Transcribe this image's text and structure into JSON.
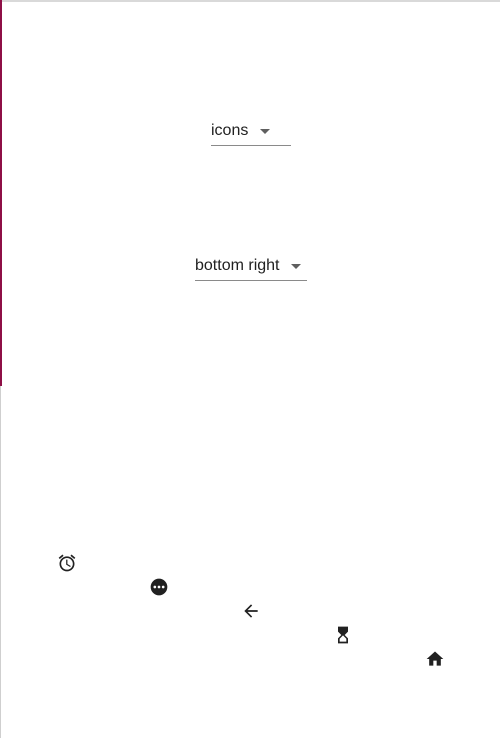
{
  "controls": {
    "mode_select": {
      "value": "icons"
    },
    "position_select": {
      "value": "bottom right"
    }
  },
  "icons": [
    {
      "name": "alarm-icon",
      "glyph": "alarm clock"
    },
    {
      "name": "more-horizontal-circle-icon",
      "glyph": "three dots in circle"
    },
    {
      "name": "arrow-back-icon",
      "glyph": "left arrow"
    },
    {
      "name": "hourglass-icon",
      "glyph": "hourglass"
    },
    {
      "name": "home-icon",
      "glyph": "house"
    }
  ],
  "colors": {
    "accent_line": "#8e0f46",
    "icon": "#212121",
    "underline": "#8a8a8a"
  }
}
